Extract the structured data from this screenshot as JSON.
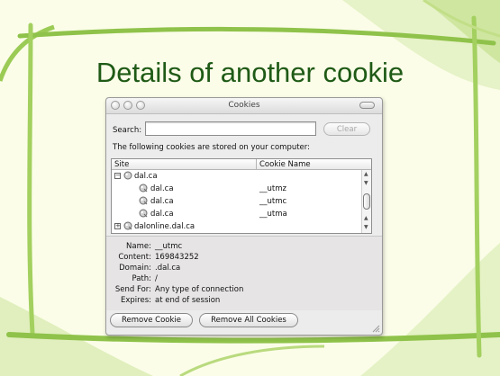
{
  "slide": {
    "title": "Details of another cookie"
  },
  "window": {
    "title": "Cookies",
    "search_label": "Search:",
    "search_value": "",
    "clear_label": "Clear",
    "info_text": "The following cookies are stored on your computer:",
    "columns": {
      "site": "Site",
      "cookie_name": "Cookie Name"
    },
    "rows": [
      {
        "site": "dal.ca",
        "cookie": ""
      },
      {
        "site": "dal.ca",
        "cookie": "__utmz"
      },
      {
        "site": "dal.ca",
        "cookie": "__utmc"
      },
      {
        "site": "dal.ca",
        "cookie": "__utma"
      },
      {
        "site": "dalonline.dal.ca",
        "cookie": ""
      }
    ],
    "details": {
      "name_label": "Name:",
      "name": "__utmc",
      "content_label": "Content:",
      "content": "169843252",
      "domain_label": "Domain:",
      "domain": ".dal.ca",
      "path_label": "Path:",
      "path": "/",
      "send_label": "Send For:",
      "send": "Any type of connection",
      "expires_label": "Expires:",
      "expires": "at end of session"
    },
    "remove_label": "Remove Cookie",
    "remove_all_label": "Remove All Cookies"
  },
  "colors": {
    "title": "#1f5a16",
    "frame_green": "#8fc24a",
    "background": "#fbfde8"
  }
}
